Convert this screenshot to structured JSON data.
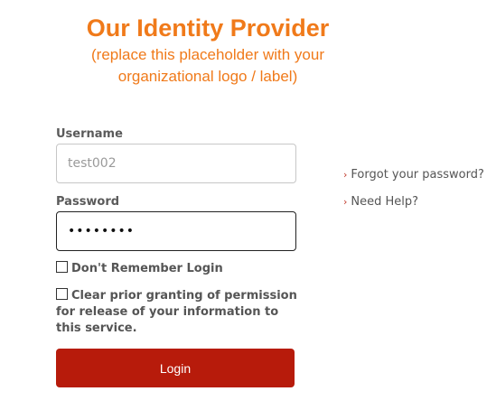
{
  "header": {
    "title": "Our Identity Provider",
    "subtitle_line1": "(replace this placeholder with your",
    "subtitle_line2": "organizational logo / label)"
  },
  "form": {
    "username_label": "Username",
    "username_value": "test002",
    "password_label": "Password",
    "password_value": "••••••••",
    "dont_remember_label": "Don't Remember Login",
    "clear_permission_line1": "Clear prior granting of permission",
    "clear_permission_line2": "for release of your information to",
    "clear_permission_line3": "this service.",
    "login_button": "Login"
  },
  "links": {
    "forgot_password": "Forgot your password?",
    "need_help": "Need Help?",
    "chevron": "›"
  },
  "colors": {
    "brand_orange": "#f07a1a",
    "login_button": "#b71b0b",
    "link_chevron": "#c0392b"
  }
}
